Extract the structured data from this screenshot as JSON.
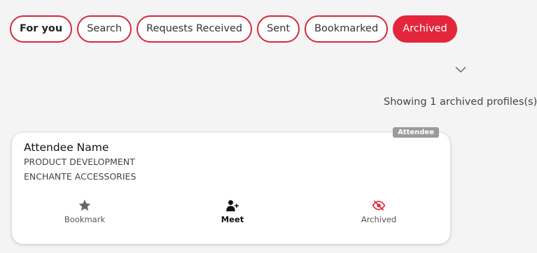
{
  "tabs": [
    {
      "label": "For you"
    },
    {
      "label": "Search"
    },
    {
      "label": "Requests Received"
    },
    {
      "label": "Sent"
    },
    {
      "label": "Bookmarked"
    },
    {
      "label": "Archived"
    }
  ],
  "active_tab": "Archived",
  "results": {
    "count_text": "Showing 1 archived profiles(s)"
  },
  "profile": {
    "badge": "Attendee",
    "name": "Attendee Name",
    "department": "PRODUCT DEVELOPMENT",
    "company": "ENCHANTE ACCESSORIES",
    "actions": [
      {
        "label": "Bookmark",
        "icon": "star-icon"
      },
      {
        "label": "Meet",
        "icon": "add-user-icon"
      },
      {
        "label": "Archived",
        "icon": "eye-slash-icon"
      }
    ]
  },
  "colors": {
    "accent": "#e3263b",
    "badge": "#9b9b9b",
    "icon_gray": "#666666",
    "icon_dark": "#111111"
  }
}
